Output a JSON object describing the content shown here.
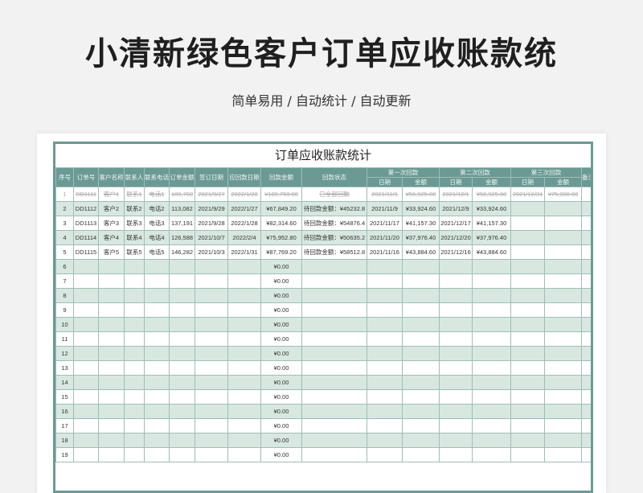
{
  "title": "小清新绿色客户订单应收账款统",
  "subtitle": "简单易用 / 自动统计 / 自动更新",
  "sheet": {
    "title": "订单应收账款统计",
    "headers": {
      "seq": "序号",
      "order_no": "订单号",
      "customer": "客户名称",
      "contact": "联系人",
      "phone": "联系电话",
      "amount": "订单金额",
      "order_date": "签订日期",
      "due_date": "应回款日期",
      "received": "回款金额",
      "status": "回款状态",
      "first": "第一次回款",
      "second": "第二次回款",
      "third": "第三次回款",
      "date": "日期",
      "money": "金额",
      "note": "备注"
    },
    "rows": [
      {
        "seq": "1",
        "order": "DD1111",
        "customer": "客户1",
        "contact": "联系1",
        "phone": "电话1",
        "amount": "189,750",
        "date": "2021/9/27",
        "due": "2022/1/28",
        "received": "¥189,750.00",
        "status": "已全部回款",
        "d1": "2021/11/1",
        "m1": "¥56,925.00",
        "d2": "2021/12/1",
        "m2": "¥56,925.00",
        "d3": "2021/12/31",
        "m3": "¥75,900.00",
        "note": ""
      },
      {
        "seq": "2",
        "order": "DD1112",
        "customer": "客户2",
        "contact": "联系2",
        "phone": "电话2",
        "amount": "113,082",
        "date": "2021/9/29",
        "due": "2022/1/27",
        "received": "¥67,849.20",
        "status": "待回款金额：¥45232.8",
        "d1": "2021/11/9",
        "m1": "¥33,924.60",
        "d2": "2021/12/9",
        "m2": "¥33,924.60",
        "d3": "",
        "m3": "",
        "note": ""
      },
      {
        "seq": "3",
        "order": "DD1113",
        "customer": "客户3",
        "contact": "联系3",
        "phone": "电话3",
        "amount": "137,191",
        "date": "2021/9/28",
        "due": "2022/1/28",
        "received": "¥82,314.60",
        "status": "待回款金额：¥54876.4",
        "d1": "2021/11/17",
        "m1": "¥41,157.30",
        "d2": "2021/12/17",
        "m2": "¥41,157.30",
        "d3": "",
        "m3": "",
        "note": ""
      },
      {
        "seq": "4",
        "order": "DD1114",
        "customer": "客户4",
        "contact": "联系4",
        "phone": "电话4",
        "amount": "126,588",
        "date": "2021/10/7",
        "due": "2022/2/4",
        "received": "¥75,952.80",
        "status": "待回款金额：¥50635.2",
        "d1": "2021/11/20",
        "m1": "¥37,976.40",
        "d2": "2021/12/20",
        "m2": "¥37,976.40",
        "d3": "",
        "m3": "",
        "note": ""
      },
      {
        "seq": "5",
        "order": "DD1115",
        "customer": "客户5",
        "contact": "联系5",
        "phone": "电话5",
        "amount": "146,282",
        "date": "2021/10/3",
        "due": "2022/1/31",
        "received": "¥87,769.20",
        "status": "待回款金额：¥58512.8",
        "d1": "2021/11/16",
        "m1": "¥43,884.60",
        "d2": "2021/12/16",
        "m2": "¥43,884.60",
        "d3": "",
        "m3": "",
        "note": ""
      },
      {
        "seq": "6",
        "received": "¥0.00"
      },
      {
        "seq": "7",
        "received": "¥0.00"
      },
      {
        "seq": "8",
        "received": "¥0.00"
      },
      {
        "seq": "9",
        "received": "¥0.00"
      },
      {
        "seq": "10",
        "received": "¥0.00"
      },
      {
        "seq": "11",
        "received": "¥0.00"
      },
      {
        "seq": "12",
        "received": "¥0.00"
      },
      {
        "seq": "13",
        "received": "¥0.00"
      },
      {
        "seq": "14",
        "received": "¥0.00"
      },
      {
        "seq": "15",
        "received": "¥0.00"
      },
      {
        "seq": "16",
        "received": "¥0.00"
      },
      {
        "seq": "17",
        "received": "¥0.00"
      },
      {
        "seq": "18",
        "received": "¥0.00"
      },
      {
        "seq": "19",
        "received": "¥0.00"
      }
    ]
  },
  "colors": {
    "header_bg": "#6a9a93",
    "row_alt": "#d8e8e1",
    "border": "#9fbdb8"
  }
}
